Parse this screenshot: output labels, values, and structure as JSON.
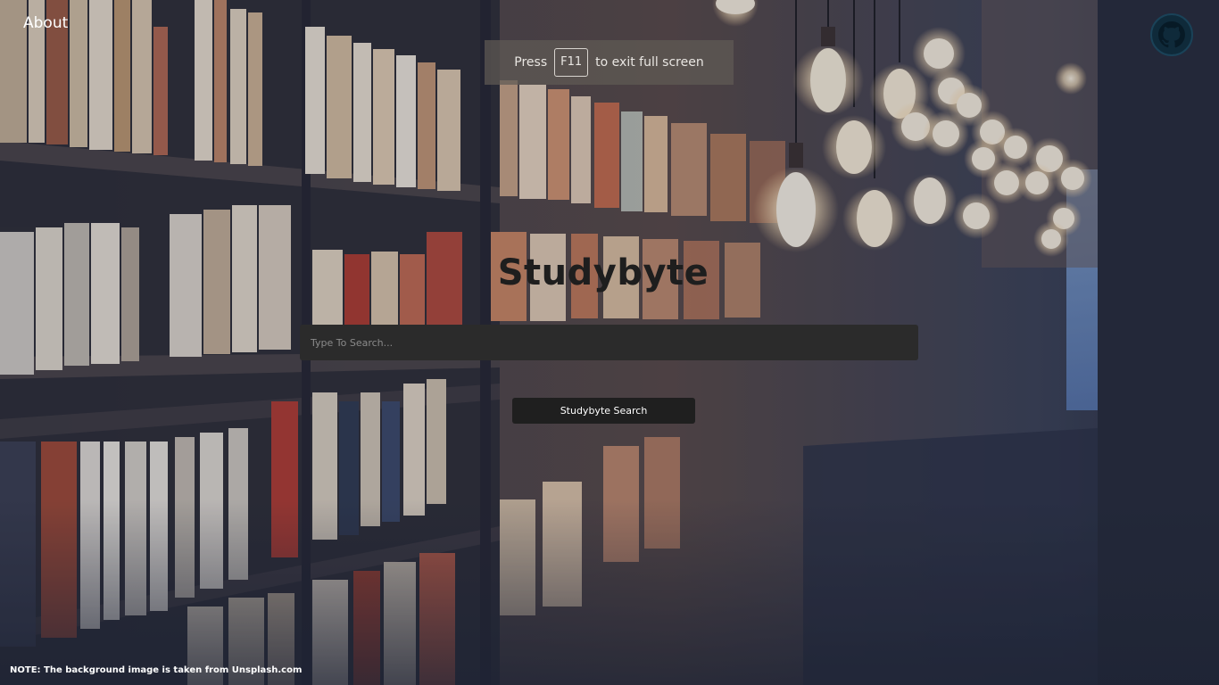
{
  "header": {
    "about_label": "About",
    "github_icon": "github-icon"
  },
  "fullscreen_hint": {
    "prefix": "Press",
    "key": "F11",
    "suffix": "to exit full screen"
  },
  "main": {
    "title": "Studybyte",
    "search_placeholder": "Type To Search...",
    "search_value": "",
    "search_button_label": "Studybyte Search"
  },
  "footer": {
    "note": "NOTE: The background image is taken from Unsplash.com"
  },
  "colors": {
    "search_bg": "#2b2b2b",
    "button_bg": "#1f1f1f",
    "title": "#1e1e1e"
  }
}
